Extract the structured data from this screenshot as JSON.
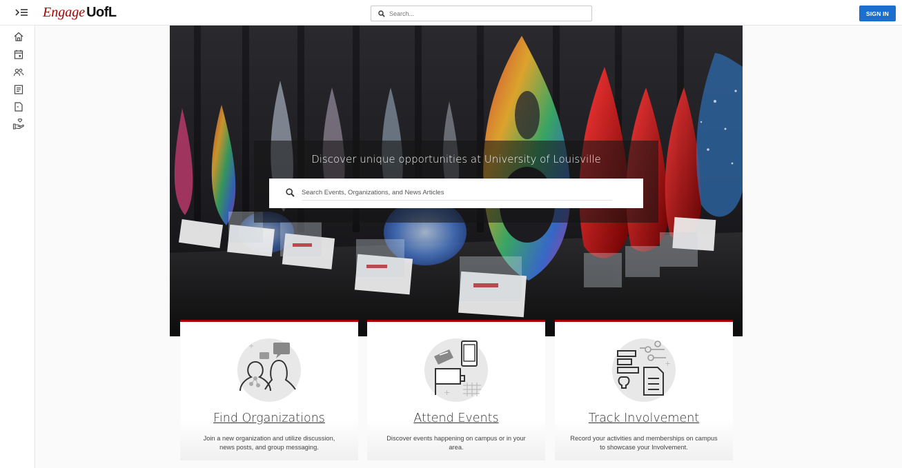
{
  "header": {
    "brand_script": "Engage",
    "brand_bold": "UofL",
    "search_placeholder": "Search...",
    "sign_in_label": "SIGN IN"
  },
  "sidebar": {
    "items": [
      {
        "name": "home",
        "icon": "home-icon"
      },
      {
        "name": "events",
        "icon": "calendar-icon"
      },
      {
        "name": "organizations",
        "icon": "people-icon"
      },
      {
        "name": "news",
        "icon": "news-icon"
      },
      {
        "name": "forms",
        "icon": "document-icon"
      },
      {
        "name": "involvement",
        "icon": "hand-heart-icon"
      }
    ]
  },
  "hero": {
    "title": "Discover unique opportunities at University of Louisville",
    "search_placeholder": "Search Events, Organizations, and News Articles"
  },
  "cards": [
    {
      "title": "Find Organizations",
      "description": "Join a new organization and utilize discussion, news posts, and group messaging."
    },
    {
      "title": "Attend Events",
      "description": "Discover events happening on campus or in your area."
    },
    {
      "title": "Track Involvement",
      "description": "Record your activities and memberships on campus to showcase your Involvement."
    }
  ],
  "colors": {
    "brand_red": "#ad0000",
    "sign_in_blue": "#1a6fcf"
  }
}
